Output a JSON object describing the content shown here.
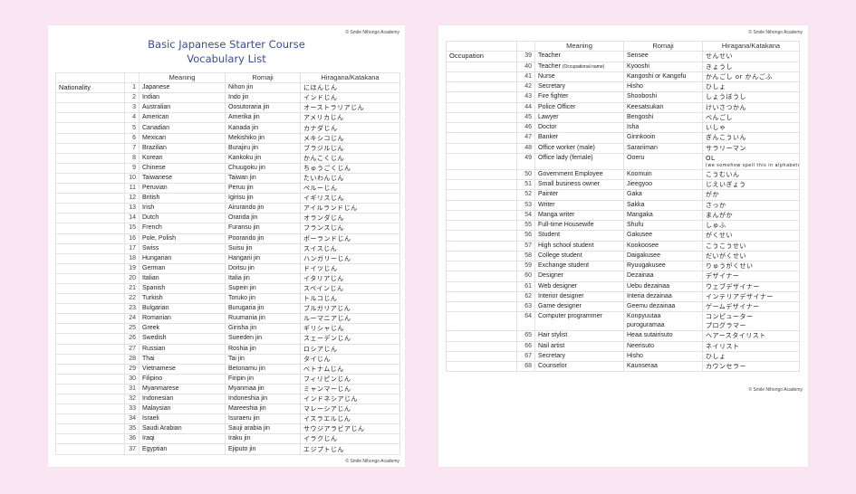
{
  "left_page": {
    "copyright": "© Smile Nihongo Academy",
    "title_line1": "Basic Japanese Starter Course",
    "title_line2": "Vocabulary List",
    "headers": [
      "",
      "",
      "Meaning",
      "Romaji",
      "Hiragana/Katakana"
    ],
    "category": "Nationality",
    "rows": [
      {
        "no": "1",
        "meaning": "Japanese",
        "romaji": "Nihon jin",
        "kana": "にほんじん"
      },
      {
        "no": "2",
        "meaning": "Indian",
        "romaji": "Indo jin",
        "kana": "インドじん"
      },
      {
        "no": "3",
        "meaning": "Australian",
        "romaji": "Oosutoraria jin",
        "kana": "オーストラリアじん"
      },
      {
        "no": "4",
        "meaning": "American",
        "romaji": "Amerika jin",
        "kana": "アメリカじん"
      },
      {
        "no": "5",
        "meaning": "Canadian",
        "romaji": "Kanada jin",
        "kana": "カナダじん"
      },
      {
        "no": "6",
        "meaning": "Mexican",
        "romaji": "Mekishiko jin",
        "kana": "メキシコじん"
      },
      {
        "no": "7",
        "meaning": "Brazilian",
        "romaji": "Burajiru jin",
        "kana": "ブラジルじん"
      },
      {
        "no": "8",
        "meaning": "Korean",
        "romaji": "Kankoku jin",
        "kana": "かんこくじん"
      },
      {
        "no": "9",
        "meaning": "Chinese",
        "romaji": "Chuugoku jin",
        "kana": "ちゅうごくじん"
      },
      {
        "no": "10",
        "meaning": "Taiwanese",
        "romaji": "Taiwan jin",
        "kana": "たいわんじん"
      },
      {
        "no": "11",
        "meaning": "Peruvian",
        "romaji": "Peruu jin",
        "kana": "ペルーじん"
      },
      {
        "no": "12",
        "meaning": "British",
        "romaji": "Igirisu jin",
        "kana": "イギリスじん"
      },
      {
        "no": "13",
        "meaning": "Irish",
        "romaji": "Airurando jin",
        "kana": "アイルランドじん"
      },
      {
        "no": "14",
        "meaning": "Dutch",
        "romaji": "Oranda jin",
        "kana": "オランダじん"
      },
      {
        "no": "15",
        "meaning": "French",
        "romaji": "Furansu jin",
        "kana": "フランスじん"
      },
      {
        "no": "16",
        "meaning": "Pole, Polish",
        "romaji": "Poorando jin",
        "kana": "ポーランドじん"
      },
      {
        "no": "17",
        "meaning": "Swiss",
        "romaji": "Suisu jin",
        "kana": "スイスじん"
      },
      {
        "no": "18",
        "meaning": "Hungarian",
        "romaji": "Hangarii jin",
        "kana": "ハンガリーじん"
      },
      {
        "no": "19",
        "meaning": "German",
        "romaji": "Doitsu jin",
        "kana": "ドイツじん"
      },
      {
        "no": "20",
        "meaning": "Italian",
        "romaji": "Italia jin",
        "kana": "イタリアじん"
      },
      {
        "no": "21",
        "meaning": "Spanish",
        "romaji": "Supein jin",
        "kana": "スペインじん"
      },
      {
        "no": "22",
        "meaning": "Turkish",
        "romaji": "Toruko jin",
        "kana": "トルコじん"
      },
      {
        "no": "23",
        "meaning": "Bulgarian",
        "romaji": "Burugaria jin",
        "kana": "ブルガリアじん"
      },
      {
        "no": "24",
        "meaning": "Romanian",
        "romaji": "Ruumania jin",
        "kana": "ルーマニアじん"
      },
      {
        "no": "25",
        "meaning": "Greek",
        "romaji": "Girisha jin",
        "kana": "ギリシャじん"
      },
      {
        "no": "26",
        "meaning": "Swedish",
        "romaji": "Sueeden jin",
        "kana": "スェーデンじん"
      },
      {
        "no": "27",
        "meaning": "Russian",
        "romaji": "Roshia jin",
        "kana": "ロシアじん"
      },
      {
        "no": "28",
        "meaning": "Thai",
        "romaji": "Tai jin",
        "kana": "タイじん"
      },
      {
        "no": "29",
        "meaning": "Vietnamese",
        "romaji": "Betonamu jin",
        "kana": "ベトナムじん"
      },
      {
        "no": "30",
        "meaning": "Filipino",
        "romaji": "Firipin jin",
        "kana": "フィリピンじん"
      },
      {
        "no": "31",
        "meaning": "Myanmarese",
        "romaji": "Myanmaa jin",
        "kana": "ミャンマーじん"
      },
      {
        "no": "32",
        "meaning": "Indonesian",
        "romaji": "Indoneshia jin",
        "kana": "インドネシアじん"
      },
      {
        "no": "33",
        "meaning": "Malaysian",
        "romaji": "Mareeshia jin",
        "kana": "マレーシアじん"
      },
      {
        "no": "34",
        "meaning": "Israeli",
        "romaji": "Isuraeru jin",
        "kana": "イスラエルじん"
      },
      {
        "no": "35",
        "meaning": "Saudi Arabian",
        "romaji": "Sauji arabia jin",
        "kana": "サウジアラビアじん"
      },
      {
        "no": "36",
        "meaning": "Iraqi",
        "romaji": "Iraku jin",
        "kana": "イラクじん"
      },
      {
        "no": "37",
        "meaning": "Egyptian",
        "romaji": "Ejiputo jin",
        "kana": "エジプトじん"
      }
    ],
    "footer_copyright": "© Smile Nihongo Academy"
  },
  "right_page": {
    "copyright": "© Smile Nihongo Academy",
    "headers": [
      "",
      "",
      "Meaning",
      "Romaji",
      "Hiragana/Katakana"
    ],
    "category": "Occupation",
    "rows": [
      {
        "no": "39",
        "meaning": "Teacher",
        "romaji": "Sensee",
        "kana": "せんせい"
      },
      {
        "no": "40",
        "meaning": "Teacher",
        "meaning_note": "(Occupational name)",
        "romaji": "Kyooshi",
        "kana": "きょうし"
      },
      {
        "no": "41",
        "meaning": "Nurse",
        "romaji": "Kangoshi or Kangofu",
        "kana": "かんごし or かんごふ"
      },
      {
        "no": "42",
        "meaning": "Secretary",
        "romaji": "Hisho",
        "kana": "ひしょ"
      },
      {
        "no": "43",
        "meaning": "Fire fighter",
        "romaji": "Shooboshi",
        "kana": "しょうぼうし"
      },
      {
        "no": "44",
        "meaning": "Police Officer",
        "romaji": "Keesatsukan",
        "kana": "けいさつかん"
      },
      {
        "no": "45",
        "meaning": "Lawyer",
        "romaji": "Bengoshi",
        "kana": "べんごし"
      },
      {
        "no": "46",
        "meaning": "Doctor",
        "romaji": "Isha",
        "kana": "いしゃ"
      },
      {
        "no": "47",
        "meaning": "Banker",
        "romaji": "Ginnkooin",
        "kana": "ぎんこういん"
      },
      {
        "no": "48",
        "meaning": "Office worker (male)",
        "romaji": "Sarariiman",
        "kana": "サラリーマン"
      },
      {
        "no": "49",
        "meaning": "Office lady (female)",
        "romaji": "Ooeru",
        "kana": "OL",
        "kana_note": "(we somehow spell this in alphabets)"
      },
      {
        "no": "50",
        "meaning": "Government Employee",
        "romaji": "Koomuin",
        "kana": "こうむいん"
      },
      {
        "no": "51",
        "meaning": "Small business owner",
        "romaji": "Jieegyoo",
        "kana": "じえいぎょう"
      },
      {
        "no": "52",
        "meaning": "Painter",
        "romaji": "Gaka",
        "kana": "がか"
      },
      {
        "no": "53",
        "meaning": "Writer",
        "romaji": "Sakka",
        "kana": "さっか"
      },
      {
        "no": "54",
        "meaning": "Manga writer",
        "romaji": "Mangaka",
        "kana": "まんがか"
      },
      {
        "no": "55",
        "meaning": "Full-time Housewife",
        "romaji": "Shufu",
        "kana": "しゅふ"
      },
      {
        "no": "56",
        "meaning": "Student",
        "romaji": "Gakusee",
        "kana": "がくせい"
      },
      {
        "no": "57",
        "meaning": "High school student",
        "romaji": "Kookoosee",
        "kana": "こうこうせい"
      },
      {
        "no": "58",
        "meaning": "College student",
        "romaji": "Daigakusee",
        "kana": "だいがくせい"
      },
      {
        "no": "59",
        "meaning": "Exchange student",
        "romaji": "Ryuugakusee",
        "kana": "りゅうがくせい"
      },
      {
        "no": "60",
        "meaning": "Designer",
        "romaji": "Dezainaa",
        "kana": "デザイナー"
      },
      {
        "no": "61",
        "meaning": "Web designer",
        "romaji": "Uebu dezainaa",
        "kana": "ウェブデザイナー"
      },
      {
        "no": "62",
        "meaning": "Interior designer",
        "romaji": "Interia dezainaa",
        "kana": "インテリアデザイナー"
      },
      {
        "no": "63",
        "meaning": "Game designer",
        "romaji": "Geemu dezainaa",
        "kana": "ゲームデザイナー"
      },
      {
        "no": "64",
        "meaning": "Computer programmer",
        "romaji": "Konpyuutaa",
        "romaji2": "puroguramaa",
        "kana": "コンピューター",
        "kana2": "プログラマー"
      },
      {
        "no": "65",
        "meaning": "Hair stylist",
        "romaji": "Heaa sutairisuto",
        "kana": "ヘアースタイリスト"
      },
      {
        "no": "66",
        "meaning": "Nail artist",
        "romaji": "Neerisuto",
        "kana": "ネイリスト"
      },
      {
        "no": "67",
        "meaning": "Secretary",
        "romaji": "Hisho",
        "kana": "ひしょ"
      },
      {
        "no": "68",
        "meaning": "Counselor",
        "romaji": "Kaunseraa",
        "kana": "カウンセラー"
      }
    ],
    "footer_copyright": "© Smile Nihongo Academy"
  }
}
